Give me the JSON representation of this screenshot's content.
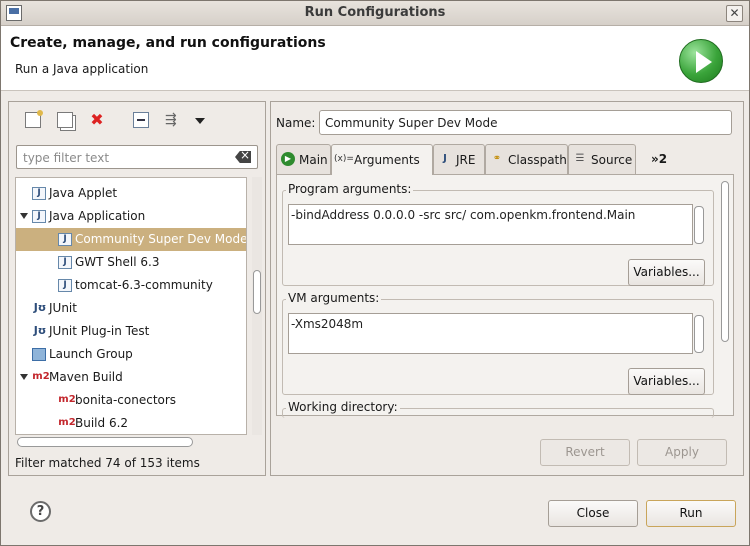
{
  "window": {
    "title": "Run Configurations"
  },
  "banner": {
    "heading": "Create, manage, and run configurations",
    "subtitle": "Run a Java application"
  },
  "left": {
    "toolbar_icons": [
      "new-config-icon",
      "duplicate-icon",
      "delete-icon",
      "collapse-all-icon",
      "filter-icon",
      "view-menu-icon"
    ],
    "filter_placeholder": "type filter text",
    "tree": [
      {
        "label": "Java Applet",
        "icon": "java-applet-icon",
        "level": 1,
        "expanded": null,
        "selected": false
      },
      {
        "label": "Java Application",
        "icon": "java-app-icon",
        "level": 1,
        "expanded": true,
        "selected": false
      },
      {
        "label": "Community Super Dev Mode",
        "icon": "java-app-icon",
        "level": 2,
        "expanded": null,
        "selected": true
      },
      {
        "label": "GWT Shell 6.3",
        "icon": "java-app-icon",
        "level": 2,
        "expanded": null,
        "selected": false
      },
      {
        "label": "tomcat-6.3-community",
        "icon": "java-app-icon",
        "level": 2,
        "expanded": null,
        "selected": false
      },
      {
        "label": "JUnit",
        "icon": "junit-icon",
        "level": 1,
        "expanded": null,
        "selected": false
      },
      {
        "label": "JUnit Plug-in Test",
        "icon": "junit-icon",
        "level": 1,
        "expanded": null,
        "selected": false
      },
      {
        "label": "Launch Group",
        "icon": "launch-group-icon",
        "level": 1,
        "expanded": null,
        "selected": false
      },
      {
        "label": "Maven Build",
        "icon": "maven-icon",
        "level": 1,
        "expanded": true,
        "selected": false
      },
      {
        "label": "bonita-conectors",
        "icon": "maven-icon",
        "level": 2,
        "expanded": null,
        "selected": false
      },
      {
        "label": "Build 6.2",
        "icon": "maven-icon",
        "level": 2,
        "expanded": null,
        "selected": false
      }
    ],
    "filter_status": "Filter matched 74 of 153 items"
  },
  "right": {
    "name_label": "Name:",
    "name_value": "Community Super Dev Mode",
    "tabs": [
      {
        "label": "Main",
        "icon": "main-tab-icon",
        "active": false
      },
      {
        "label": "Arguments",
        "icon": "arguments-icon",
        "active": true
      },
      {
        "label": "JRE",
        "icon": "jre-icon",
        "active": false
      },
      {
        "label": "Classpath",
        "icon": "classpath-icon",
        "active": false
      },
      {
        "label": "Source",
        "icon": "source-icon",
        "active": false
      }
    ],
    "tab_overflow": "»2",
    "program_args": {
      "title": "Program arguments:",
      "value": "-bindAddress 0.0.0.0 -src src/ com.openkm.frontend.Main",
      "variables_label": "Variables..."
    },
    "vm_args": {
      "title": "VM arguments:",
      "value": "-Xms2048m",
      "variables_label": "Variables..."
    },
    "working_dir": {
      "title": "Working directory:"
    },
    "revert_label": "Revert",
    "apply_label": "Apply"
  },
  "footer": {
    "help_label": "?",
    "close_label": "Close",
    "run_label": "Run"
  }
}
